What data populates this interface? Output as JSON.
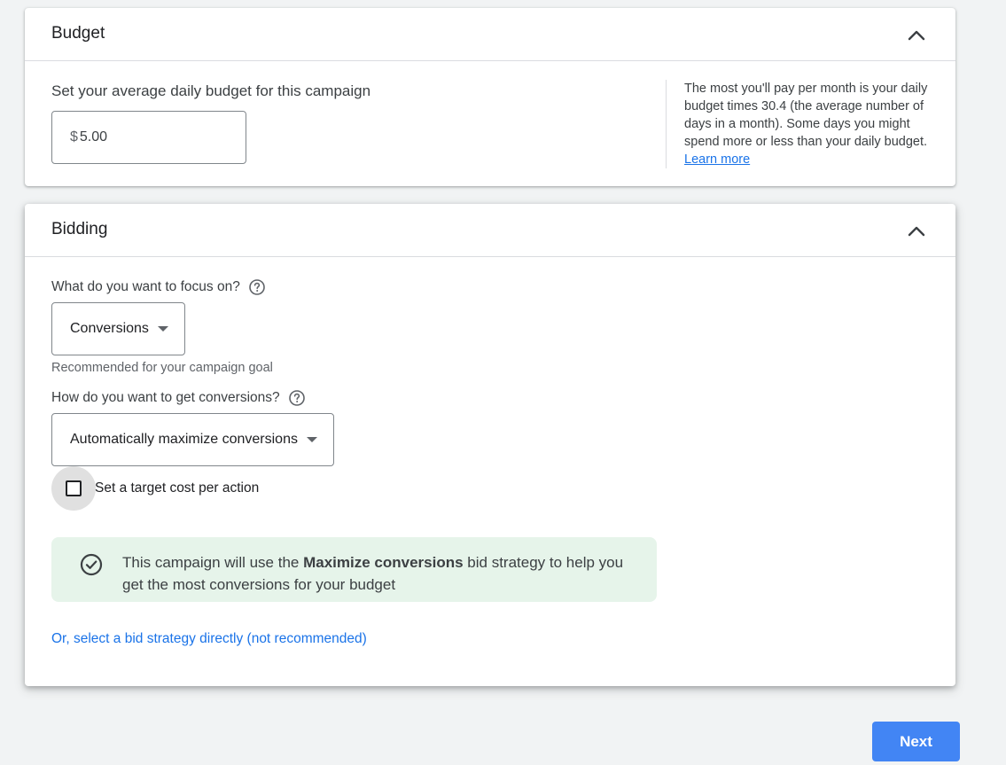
{
  "budget": {
    "title": "Budget",
    "label": "Set your average daily budget for this campaign",
    "currency_symbol": "$",
    "value": "5.00",
    "help_text": "The most you'll pay per month is your daily budget times 30.4 (the average number of days in a month). Some days you might spend more or less than your daily budget.",
    "learn_more_label": "Learn more"
  },
  "bidding": {
    "title": "Bidding",
    "focus_question": "What do you want to focus on?",
    "focus_value": "Conversions",
    "focus_note": "Recommended for your campaign goal",
    "conversions_question": "How do you want to get conversions?",
    "conversions_value": "Automatically maximize conversions",
    "target_cpa_label": "Set a target cost per action",
    "target_cpa_checked": false,
    "banner_prefix": "This campaign will use the ",
    "banner_bold": "Maximize conversions",
    "banner_suffix": " bid strategy to help you get the most conversions for your budget",
    "bid_strategy_link": "Or, select a bid strategy directly (not recommended)"
  },
  "footer": {
    "next_label": "Next"
  },
  "colors": {
    "accent": "#1a73e8",
    "primary_button": "#4285f4",
    "banner_bg": "#e6f4ea",
    "page_bg": "#f1f3f4"
  },
  "icons": {
    "collapse": "chevron-up-icon",
    "help": "help-circle-icon",
    "dropdown": "caret-down-icon",
    "banner": "check-circle-icon"
  }
}
